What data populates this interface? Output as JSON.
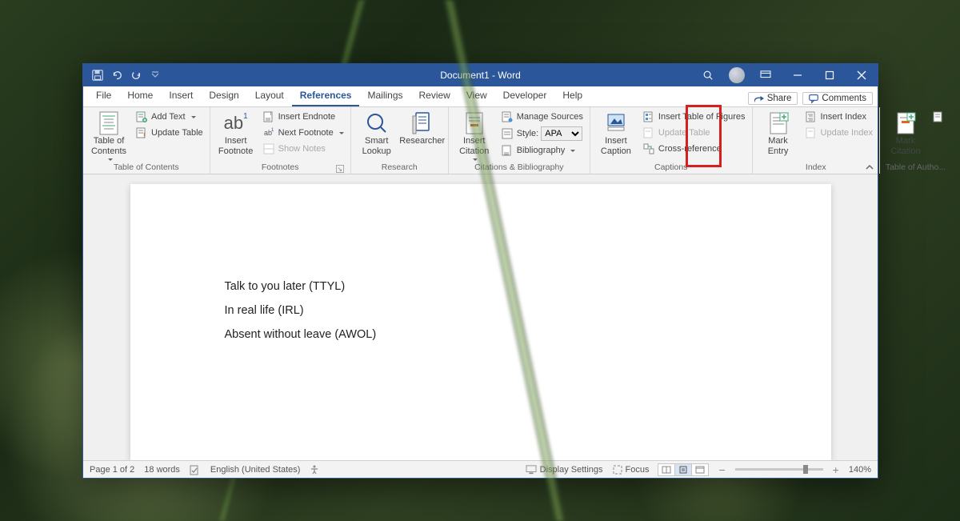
{
  "window_title": "Document1 - Word",
  "tabs": [
    "File",
    "Home",
    "Insert",
    "Design",
    "Layout",
    "References",
    "Mailings",
    "Review",
    "View",
    "Developer",
    "Help"
  ],
  "active_tab": "References",
  "share_label": "Share",
  "comments_label": "Comments",
  "ribbon": {
    "toc": {
      "big": "Table of\nContents",
      "addText": "Add Text",
      "updateTable": "Update Table",
      "group": "Table of Contents"
    },
    "footnotes": {
      "big": "Insert\nFootnote",
      "ab": "ab",
      "sup": "1",
      "insertEndnote": "Insert Endnote",
      "nextFootnote": "Next Footnote",
      "showNotes": "Show Notes",
      "group": "Footnotes"
    },
    "research": {
      "smart": "Smart\nLookup",
      "researcher": "Researcher",
      "group": "Research"
    },
    "citations": {
      "big": "Insert\nCitation",
      "manage": "Manage Sources",
      "styleLabel": "Style:",
      "styleValue": "APA",
      "biblio": "Bibliography",
      "group": "Citations & Bibliography"
    },
    "captions": {
      "big": "Insert\nCaption",
      "tof": "Insert Table of Figures",
      "update": "Update Table",
      "cross": "Cross-reference",
      "group": "Captions"
    },
    "index": {
      "big": "Mark\nEntry",
      "insertIndex": "Insert Index",
      "updateIndex": "Update Index",
      "group": "Index"
    },
    "authorities": {
      "big": "Mark\nCitation",
      "group": "Table of Autho..."
    }
  },
  "document_lines": [
    "Talk to you later (TTYL)",
    "In real life (IRL)",
    "Absent without leave (AWOL)"
  ],
  "status": {
    "page": "Page 1 of 2",
    "words": "18 words",
    "lang": "English (United States)",
    "display": "Display Settings",
    "focus": "Focus",
    "zoom": "140%"
  }
}
